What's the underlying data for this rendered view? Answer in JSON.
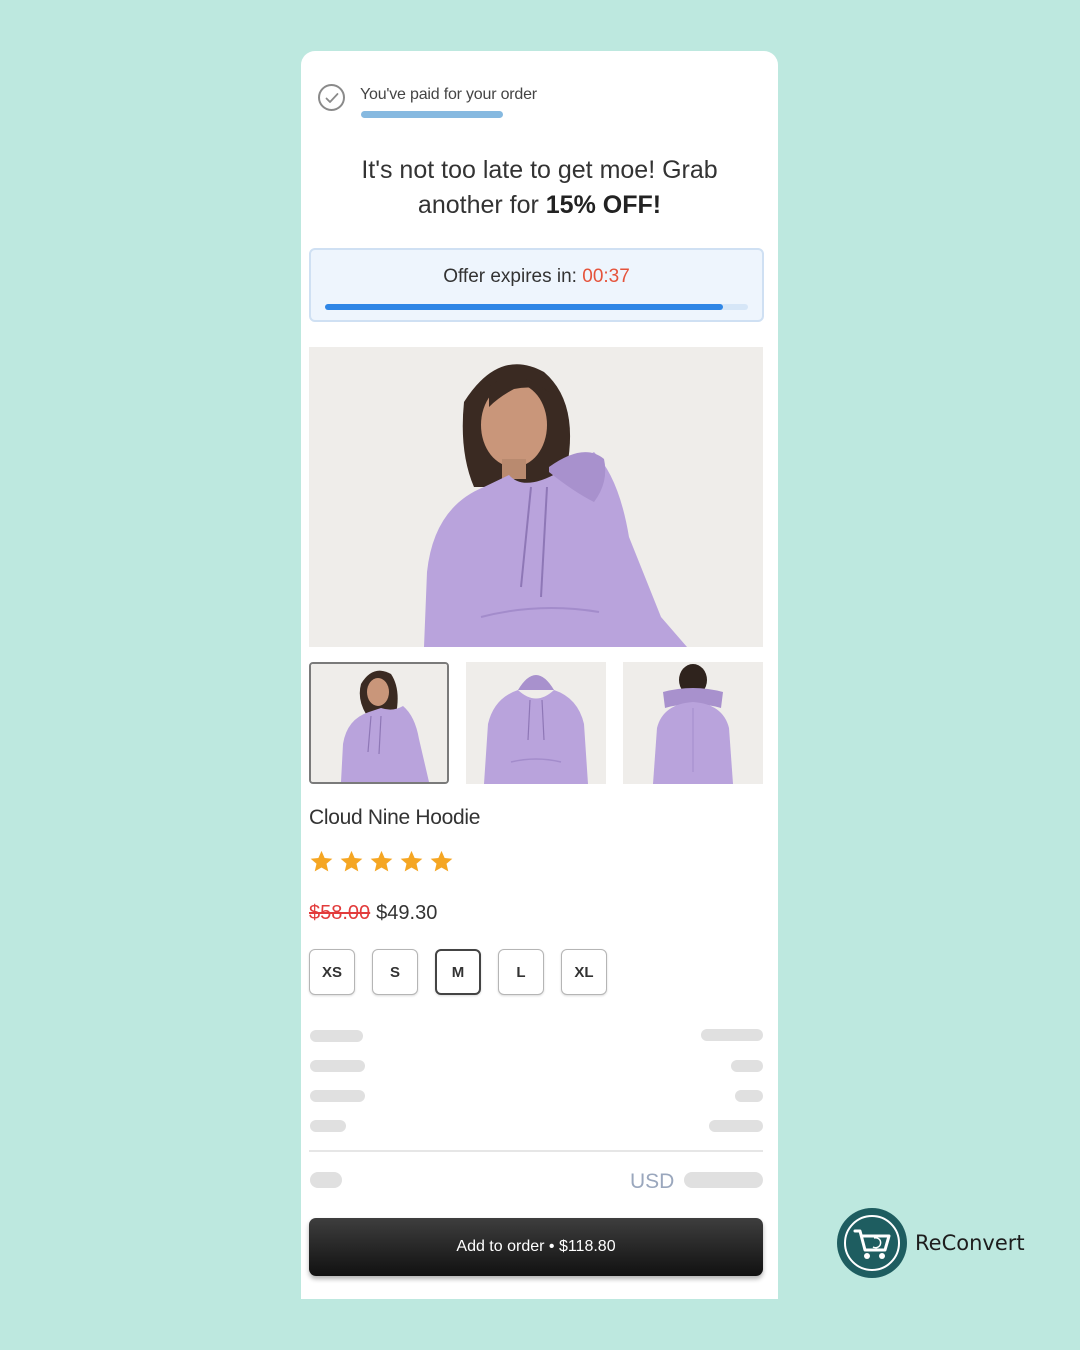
{
  "header": {
    "paid_text": "You've paid for your order"
  },
  "offer": {
    "headline_part1": "It's not too late to get moe! Grab another for ",
    "headline_bold": "15% OFF!",
    "timer_label": "Offer expires in: ",
    "timer_value": "00:37",
    "timer_progress": 0.94
  },
  "product": {
    "name": "Cloud Nine Hoodie",
    "rating": 5,
    "rating_max": 5,
    "old_price": "$58.00",
    "new_price": "$49.30",
    "sizes": [
      "XS",
      "S",
      "M",
      "L",
      "XL"
    ],
    "selected_size": "M"
  },
  "summary": {
    "currency": "USD"
  },
  "cta": {
    "label": "Add to order • $118.80"
  },
  "brand": {
    "name": "ReConvert"
  },
  "colors": {
    "background": "#bde8df",
    "timer_value": "#e5533b",
    "old_price": "#e23b3b",
    "progress": "#2f86e6",
    "hoodie": "#b9a3dc",
    "star": "#f5a623",
    "brand_logo": "#1e5d60"
  }
}
